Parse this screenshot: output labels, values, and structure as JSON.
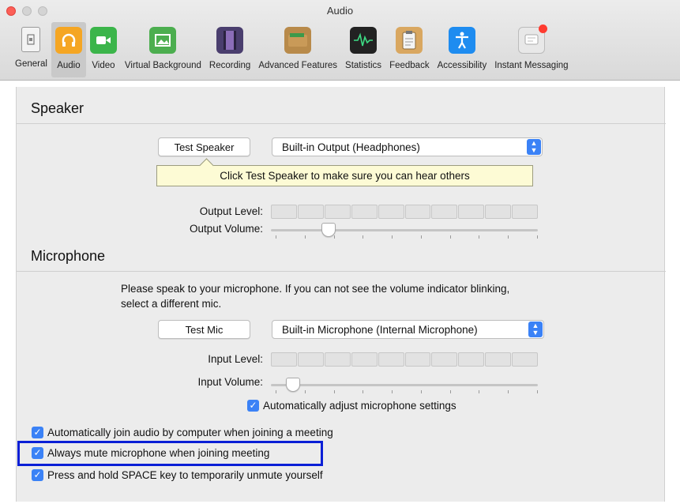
{
  "window": {
    "title": "Audio"
  },
  "toolbar": {
    "tabs": [
      {
        "label": "General",
        "icon": "general-icon"
      },
      {
        "label": "Audio",
        "icon": "headphones-icon",
        "active": true
      },
      {
        "label": "Video",
        "icon": "video-camera-icon"
      },
      {
        "label": "Virtual Background",
        "icon": "picture-icon"
      },
      {
        "label": "Recording",
        "icon": "film-icon"
      },
      {
        "label": "Advanced Features",
        "icon": "wallet-icon"
      },
      {
        "label": "Statistics",
        "icon": "waveform-icon"
      },
      {
        "label": "Feedback",
        "icon": "clipboard-icon"
      },
      {
        "label": "Accessibility",
        "icon": "accessibility-icon"
      },
      {
        "label": "Instant Messaging",
        "icon": "chat-icon"
      }
    ]
  },
  "speaker": {
    "title": "Speaker",
    "test_button": "Test Speaker",
    "device": "Built-in Output (Headphones)",
    "tooltip": "Click Test Speaker to make sure you can hear others",
    "output_level_label": "Output Level:",
    "output_volume_label": "Output Volume:",
    "output_volume_fraction": 0.2
  },
  "microphone": {
    "title": "Microphone",
    "instruction_line1": "Please speak to your microphone. If you can not see the volume indicator blinking,",
    "instruction_line2": "select a different mic.",
    "test_button": "Test Mic",
    "device": "Built-in Microphone (Internal Microphone)",
    "input_level_label": "Input Level:",
    "input_volume_label": "Input Volume:",
    "input_volume_fraction": 0.06,
    "auto_adjust_label": "Automatically adjust microphone settings",
    "auto_adjust_checked": true
  },
  "options": {
    "auto_join_label": "Automatically join audio by computer when joining a meeting",
    "auto_join_checked": true,
    "always_mute_label": "Always mute microphone when joining meeting",
    "always_mute_checked": true,
    "space_unmute_label": "Press and hold SPACE key to temporarily unmute yourself",
    "space_unmute_checked": true
  },
  "colors": {
    "accent": "#3b82f6",
    "highlight_box": "#0a1fd6",
    "tooltip_bg": "#fdfbd5"
  }
}
